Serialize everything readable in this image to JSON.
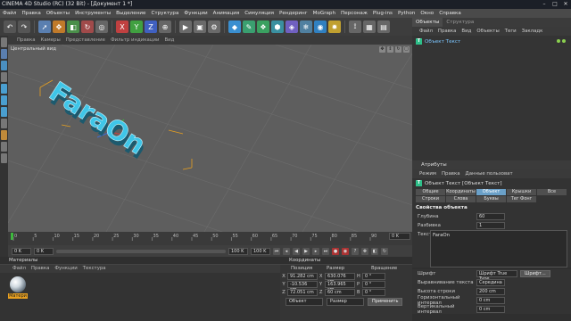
{
  "window": {
    "title": "CINEMA 4D Studio (RC) (32 Bit) - [Документ 1 *]",
    "min_icon": "minimize-icon",
    "max_icon": "maximize-icon",
    "close_icon": "close-icon"
  },
  "menubar": {
    "items": [
      "Файл",
      "Правка",
      "Объекты",
      "Инструменты",
      "Выделение",
      "Структура",
      "Функции",
      "Анимация",
      "Симуляция",
      "Рендеринг",
      "MoGraph",
      "Персонаж",
      "Plug-ins",
      "Python",
      "Окно",
      "Справка"
    ]
  },
  "viewport": {
    "menu": [
      "Правка",
      "Камеры",
      "Представление",
      "Фильтр индикации",
      "Вид"
    ],
    "label": "Центральный вид",
    "title_text": "FaraOn"
  },
  "timeline": {
    "ticks": [
      "0",
      "5",
      "10",
      "15",
      "20",
      "25",
      "30",
      "35",
      "40",
      "45",
      "50",
      "55",
      "60",
      "65",
      "70",
      "75",
      "80",
      "85",
      "90"
    ],
    "end_field": "0 K",
    "current": "0 K",
    "start": "0 K",
    "end": "100 K",
    "end2": "100 K"
  },
  "materials": {
    "title": "Материалы",
    "menu": [
      "Файл",
      "Правка",
      "Функции",
      "Текстура"
    ],
    "items": [
      {
        "name": "Матери"
      }
    ]
  },
  "coordinates": {
    "title": "Координаты",
    "headers": [
      "Позиция",
      "Размер",
      "Вращение"
    ],
    "rows": [
      {
        "axis": "X",
        "pos": "91.282 cm",
        "size": "630.076 cm",
        "rot_axis": "H",
        "rot": "0 °"
      },
      {
        "axis": "Y",
        "pos": "-10.536 cm",
        "size": "163.965 cm",
        "rot_axis": "P",
        "rot": "0 °"
      },
      {
        "axis": "Z",
        "pos": "72.051 cm",
        "size": "60 cm",
        "rot_axis": "B",
        "rot": "0 °"
      }
    ],
    "mode_select": "Объект",
    "size_select": "Размер",
    "apply_button": "Применить"
  },
  "objects": {
    "tabs": [
      "Объекты",
      "Структура"
    ],
    "menu": [
      "Файл",
      "Правка",
      "Вид",
      "Объекты",
      "Теги",
      "Закладк"
    ],
    "items": [
      {
        "name": "Объект Текст",
        "icon": "text-object-icon"
      }
    ]
  },
  "attributes": {
    "title": "Атрибуты",
    "menu": [
      "Режим",
      "Правка",
      "Данные пользоват"
    ],
    "object_label": "Объект Текст [Объект Текст]",
    "tabs_row1": [
      "Общие",
      "Координаты",
      "Объект",
      "Крышки",
      "Все"
    ],
    "tabs_row2": [
      "Строки",
      "Слова",
      "Буквы",
      "Тег Фонг"
    ],
    "active_tab": "Объект",
    "section": "Свойства объекта",
    "props": [
      {
        "label": "Глубина",
        "value": "60"
      },
      {
        "label": "Разбивка",
        "value": "1"
      }
    ],
    "text_label": "Текст",
    "text_value": "FaraOn",
    "font_label": "Шрифт",
    "font_value": "Шрифт True Type",
    "font_btn": "Шрифт...",
    "lower_props": [
      {
        "label": "Выравнивание текста",
        "value": "Середина"
      },
      {
        "label": "Высота строки",
        "value": "200 cm"
      },
      {
        "label": "Горизонтальный интервал",
        "value": "0 cm"
      },
      {
        "label": "Вертикальный интервал",
        "value": "0 cm"
      }
    ]
  },
  "colors": {
    "text_cyan": "#3fc6e8",
    "text_dark": "#1c5a6e",
    "accent_blue": "#6aa0c8",
    "bbox_orange": "#e8a020"
  }
}
